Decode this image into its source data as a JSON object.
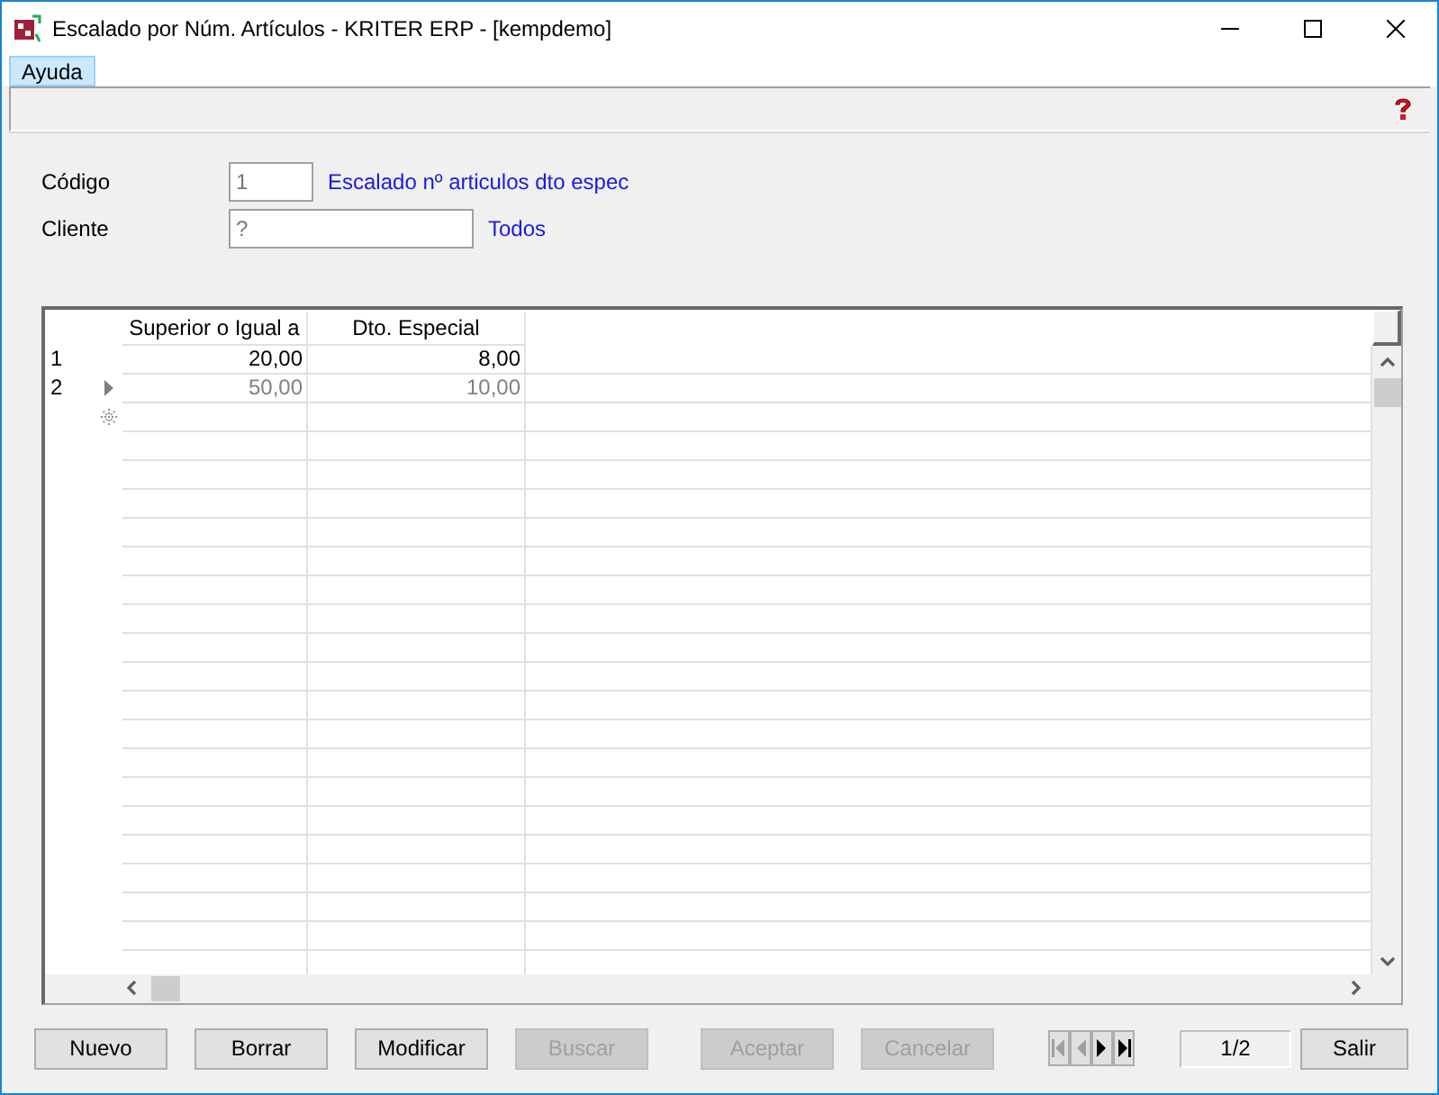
{
  "window": {
    "title": "Escalado por Núm. Artículos - KRITER ERP - [kempdemo]"
  },
  "menu": [
    {
      "label": "Ayuda",
      "selected": true
    }
  ],
  "form": {
    "fields": [
      {
        "label": "Código",
        "value": "1",
        "link": "Escalado nº articulos dto espec"
      },
      {
        "label": "Cliente",
        "value": "?",
        "link": "Todos"
      }
    ]
  },
  "table": {
    "columns": [
      "Superior o Igual a",
      "Dto. Especial"
    ],
    "rows": [
      {
        "number": "1",
        "cells": [
          "20,00",
          "8,00"
        ],
        "current": false
      },
      {
        "number": "2",
        "cells": [
          "50,00",
          "10,00"
        ],
        "current": true
      }
    ]
  },
  "buttons": [
    {
      "label": "Nuevo",
      "disabled": false
    },
    {
      "label": "Borrar",
      "disabled": false
    },
    {
      "label": "Modificar",
      "disabled": false
    },
    {
      "label": "Buscar",
      "disabled": true
    },
    {
      "label": "Aceptar",
      "disabled": true
    },
    {
      "label": "Cancelar",
      "disabled": true
    }
  ],
  "navigator": {
    "first": {
      "disabled": true
    },
    "previous": {
      "disabled": true
    },
    "next": {
      "disabled": false
    },
    "last": {
      "disabled": false
    },
    "position": "1/2"
  },
  "exit_button": {
    "label": "Salir",
    "disabled": false
  }
}
